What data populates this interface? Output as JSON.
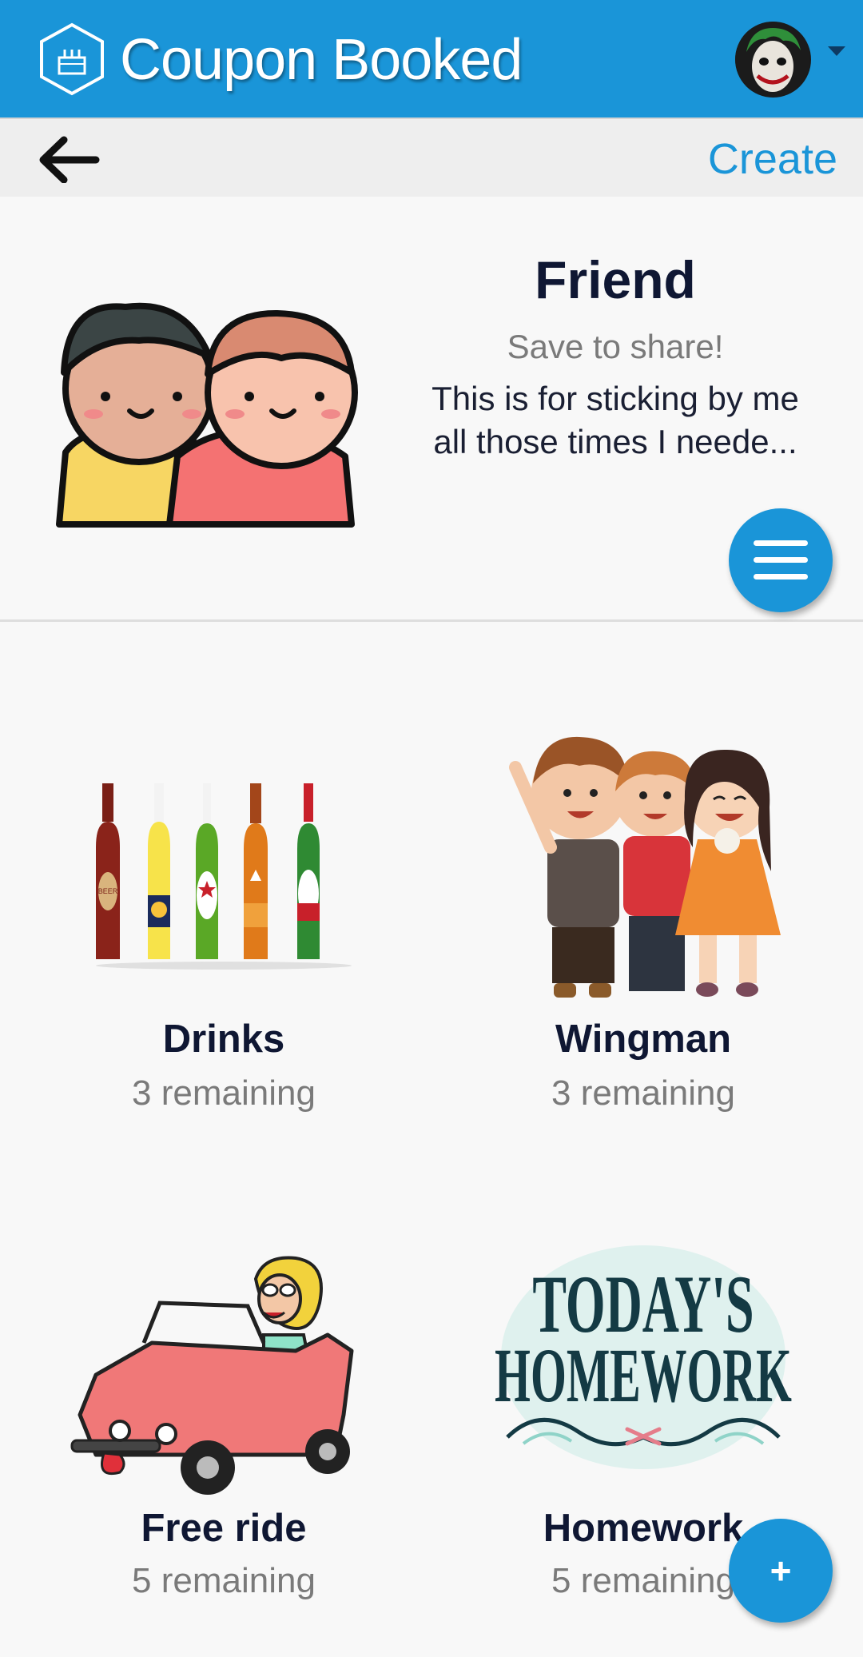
{
  "header": {
    "app_title": "Coupon Booked",
    "logo_icon": "hexagon-cake-icon",
    "avatar_icon": "joker-avatar",
    "dropdown_icon": "caret-down-icon",
    "accent_color": "#1a95d8"
  },
  "subbar": {
    "back_icon": "arrow-left-icon",
    "create_label": "Create"
  },
  "book": {
    "title": "Friend",
    "subtitle": "Save to share!",
    "description_line1": "This is for sticking by me",
    "description_line2": "all those times I neede...",
    "menu_icon": "hamburger-menu-icon"
  },
  "coupons": [
    {
      "title": "Drinks",
      "remaining": "3 remaining",
      "image": "beer-bottles"
    },
    {
      "title": "Wingman",
      "remaining": "3 remaining",
      "image": "three-friends"
    },
    {
      "title": "Free ride",
      "remaining": "5 remaining",
      "image": "pink-car"
    },
    {
      "title": "Homework",
      "remaining": "5 remaining",
      "image": "todays-homework-lettering"
    }
  ],
  "fab": {
    "label": "+"
  },
  "image_text": {
    "bottle_label": "BEER",
    "homework_line1": "TODAY'S",
    "homework_line2": "HOMEWORK"
  }
}
